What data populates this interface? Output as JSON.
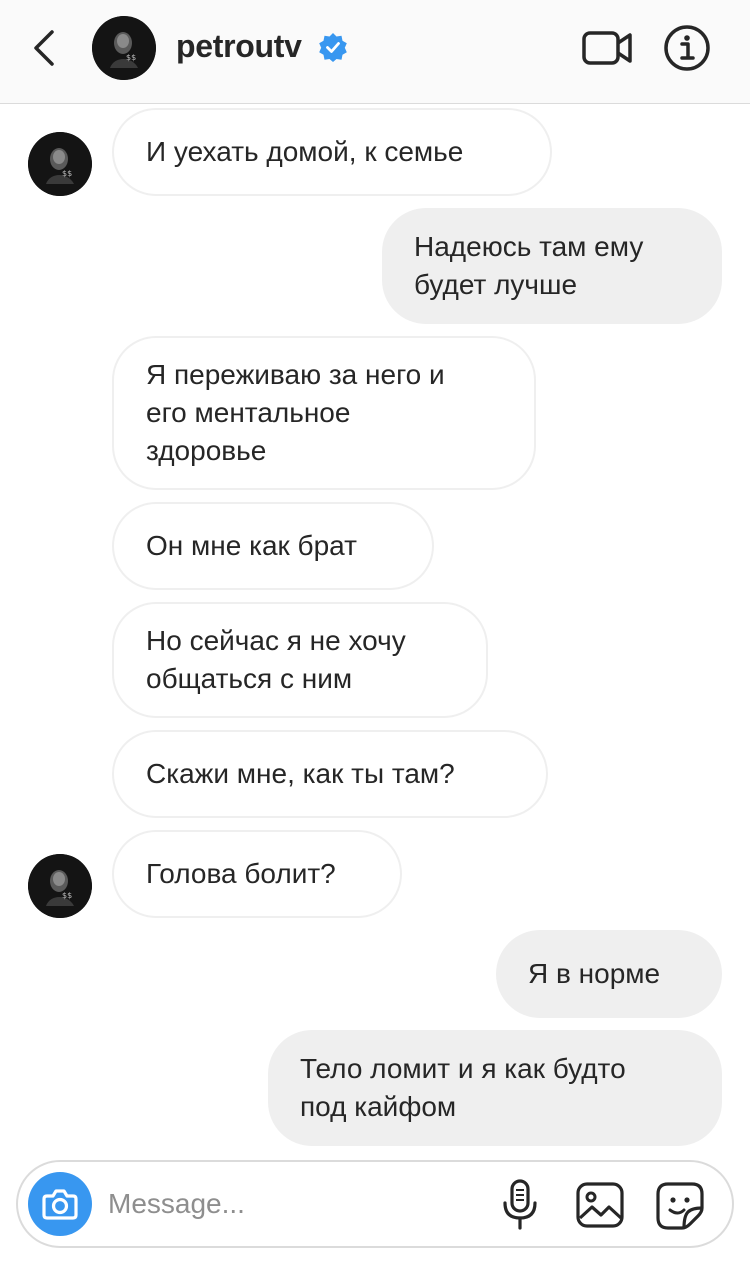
{
  "header": {
    "username": "petroutv",
    "verified": true,
    "icons": {
      "back": "chevron-left-icon",
      "video": "video-camera-icon",
      "info": "info-icon",
      "verified": "verified-badge-icon"
    }
  },
  "messages": [
    {
      "side": "in",
      "text": "И уехать домой, к семье",
      "avatar": true
    },
    {
      "side": "out",
      "text": "Надеюсь там ему\nбудет лучше"
    },
    {
      "side": "in",
      "text": "Я переживаю за него и\nего ментальное\nздоровье"
    },
    {
      "side": "in",
      "text": "Он мне как брат"
    },
    {
      "side": "in",
      "text": "Но сейчас я не хочу\nобщаться с ним"
    },
    {
      "side": "in",
      "text": "Скажи мне, как ты там?"
    },
    {
      "side": "in",
      "text": "Голова болит?",
      "avatar": true
    },
    {
      "side": "out",
      "text": "Я в норме"
    },
    {
      "side": "out",
      "text": "Тело ломит и я как будто\nпод кайфом"
    }
  ],
  "composer": {
    "placeholder": "Message...",
    "icons": {
      "camera": "camera-icon",
      "mic": "microphone-icon",
      "gallery": "gallery-icon",
      "sticker": "sticker-icon"
    }
  },
  "colors": {
    "accent": "#3897f0",
    "incoming_bubble_border": "#efefef",
    "outgoing_bubble": "#efefef",
    "header_bg": "#fafafa"
  }
}
